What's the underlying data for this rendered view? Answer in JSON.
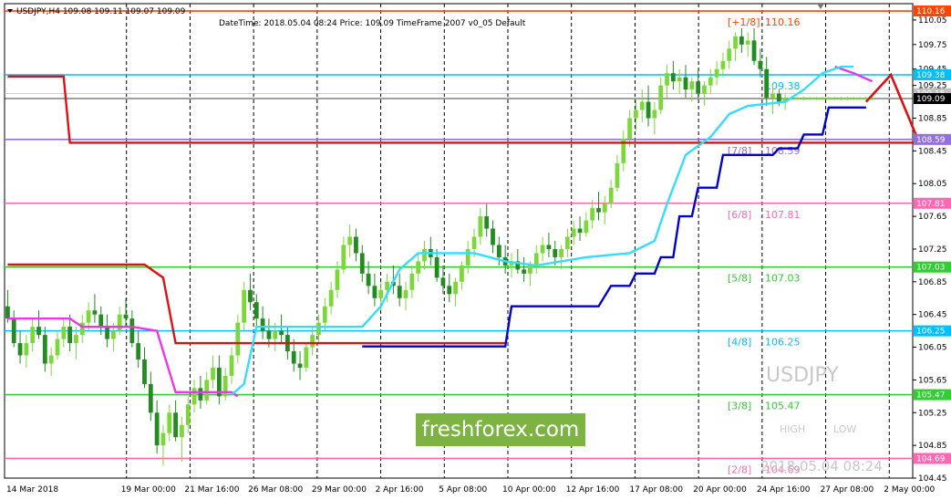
{
  "header": {
    "symbol_info": "USDJPY,H4  109.08 109.11 109.07 109.09",
    "info_line": "DateTime: 2018.05.04 08:24   Price: 109.09   TimeFrame 2007 v0_05   Default"
  },
  "watermark": {
    "symbol": "USDJPY",
    "high_label": "HIGH",
    "low_label": "LOW",
    "timestamp": "2018.05.04 08:24"
  },
  "logo": {
    "text": "freshforex.com"
  },
  "colors": {
    "bear_candle": "#228b22",
    "bull_candle": "#7cd83a",
    "red_line": "#dd1111",
    "blue_line": "#0000cc",
    "cyan_line": "#33ddff",
    "magenta_line": "#ee33ee",
    "badge_gray": "#c0c0c0",
    "badge_black": "#000000"
  },
  "chart_data": {
    "type": "candlestick",
    "ylim": [
      104.45,
      110.25
    ],
    "x_labels": [
      "14 Mar 2018",
      "19 Mar 00:00",
      "21 Mar 16:00",
      "26 Mar 08:00",
      "29 Mar 00:00",
      "2 Apr 16:00",
      "5 Apr 08:00",
      "10 Apr 00:00",
      "12 Apr 16:00",
      "17 Apr 08:00",
      "20 Apr 00:00",
      "24 Apr 16:00",
      "27 Apr 08:00",
      "2 May 00:00"
    ],
    "y_ticks": [
      "110.05",
      "109.75",
      "109.45",
      "109.25",
      "108.85",
      "108.45",
      "108.05",
      "107.65",
      "107.25",
      "106.85",
      "106.45",
      "106.05",
      "105.65",
      "105.25",
      "104.85",
      "104.45"
    ],
    "murrey_levels": [
      {
        "label": "[+1/8]",
        "value_text": "110.16",
        "value": 110.16,
        "color": "#ff4500",
        "show_text": true
      },
      {
        "label": "",
        "value_text": "109.38",
        "value": 109.38,
        "color": "#00bfff",
        "show_text": true
      },
      {
        "label": "[7/8]",
        "value_text": "108.59",
        "value": 108.59,
        "color": "#9370db",
        "show_text": true
      },
      {
        "label": "[6/8]",
        "value_text": "107.81",
        "value": 107.81,
        "color": "#ff69b4",
        "show_text": true
      },
      {
        "label": "[5/8]",
        "value_text": "107.03",
        "value": 107.03,
        "color": "#32cd32",
        "show_text": true
      },
      {
        "label": "[4/8]",
        "value_text": "106.25",
        "value": 106.25,
        "color": "#00bfff",
        "show_text": true
      },
      {
        "label": "[3/8]",
        "value_text": "105.47",
        "value": 105.47,
        "color": "#32cd32",
        "show_text": true
      },
      {
        "label": "[2/8]",
        "value_text": "104.69",
        "value": 104.69,
        "color": "#ff69b4",
        "show_text": true
      }
    ],
    "price_badges": [
      {
        "text": "109.15",
        "value": 109.15,
        "color": "#c0c0c0"
      },
      {
        "text": "109.09",
        "value": 109.09,
        "color": "#000000"
      }
    ],
    "red_line": [
      [
        0,
        109.36
      ],
      [
        9,
        109.36
      ],
      [
        10,
        108.55
      ],
      [
        168,
        108.55
      ],
      [
        170,
        108.55
      ]
    ],
    "red_line2": [
      [
        0,
        107.06
      ],
      [
        22,
        107.06
      ],
      [
        25,
        106.9
      ],
      [
        27,
        106.1
      ],
      [
        80,
        106.1
      ]
    ],
    "blue_line": [
      [
        57,
        106.06
      ],
      [
        80,
        106.06
      ],
      [
        81,
        106.55
      ],
      [
        95,
        106.55
      ],
      [
        97,
        106.8
      ],
      [
        100,
        106.8
      ],
      [
        101,
        106.95
      ],
      [
        104,
        106.95
      ],
      [
        105,
        107.15
      ],
      [
        107,
        107.15
      ],
      [
        108,
        107.65
      ],
      [
        110,
        107.65
      ],
      [
        111,
        108.0
      ],
      [
        114,
        108.0
      ],
      [
        115,
        108.4
      ],
      [
        123,
        108.4
      ],
      [
        124,
        108.48
      ],
      [
        127,
        108.48
      ],
      [
        128,
        108.65
      ],
      [
        131,
        108.65
      ],
      [
        132,
        108.98
      ],
      [
        138,
        108.98
      ]
    ],
    "cyan_line": [
      [
        36,
        105.47
      ],
      [
        38,
        105.6
      ],
      [
        40,
        106.3
      ],
      [
        57,
        106.3
      ],
      [
        60,
        106.55
      ],
      [
        63,
        107.0
      ],
      [
        66,
        107.2
      ],
      [
        75,
        107.2
      ],
      [
        80,
        107.1
      ],
      [
        85,
        107.05
      ],
      [
        93,
        107.15
      ],
      [
        100,
        107.2
      ],
      [
        104,
        107.35
      ],
      [
        106,
        107.8
      ],
      [
        109,
        108.4
      ],
      [
        113,
        108.62
      ],
      [
        116,
        108.9
      ],
      [
        119,
        109.0
      ],
      [
        125,
        109.05
      ],
      [
        128,
        109.2
      ],
      [
        131,
        109.4
      ],
      [
        134,
        109.48
      ],
      [
        136,
        109.48
      ]
    ],
    "magenta_line": [
      [
        0,
        106.4
      ],
      [
        10,
        106.4
      ],
      [
        12,
        106.3
      ],
      [
        20,
        106.3
      ],
      [
        24,
        106.25
      ],
      [
        27,
        105.5
      ],
      [
        36,
        105.5
      ],
      [
        37,
        105.45
      ]
    ],
    "magenta_line2": [
      [
        133,
        109.48
      ],
      [
        136,
        109.4
      ],
      [
        139,
        109.3
      ]
    ],
    "forecast_line": [
      [
        138,
        109.05
      ],
      [
        142,
        109.38
      ],
      [
        146,
        108.65
      ]
    ],
    "n_bars": 140,
    "candles": [
      [
        106.55,
        106.75,
        106.35,
        106.4
      ],
      [
        106.4,
        106.5,
        106.05,
        106.1
      ],
      [
        106.1,
        106.25,
        105.85,
        105.95
      ],
      [
        105.95,
        106.2,
        105.8,
        106.1
      ],
      [
        106.1,
        106.4,
        106.0,
        106.3
      ],
      [
        106.3,
        106.5,
        106.15,
        106.2
      ],
      [
        106.2,
        106.3,
        105.75,
        105.85
      ],
      [
        105.85,
        106.05,
        105.7,
        105.95
      ],
      [
        105.95,
        106.25,
        105.9,
        106.15
      ],
      [
        106.15,
        106.4,
        106.05,
        106.3
      ],
      [
        106.3,
        106.45,
        106.0,
        106.1
      ],
      [
        106.1,
        106.3,
        105.9,
        106.2
      ],
      [
        106.2,
        106.45,
        106.1,
        106.35
      ],
      [
        106.35,
        106.6,
        106.25,
        106.5
      ],
      [
        106.5,
        106.7,
        106.35,
        106.45
      ],
      [
        106.45,
        106.55,
        106.2,
        106.3
      ],
      [
        106.3,
        106.45,
        106.05,
        106.15
      ],
      [
        106.15,
        106.35,
        106.0,
        106.25
      ],
      [
        106.25,
        106.55,
        106.2,
        106.45
      ],
      [
        106.45,
        106.65,
        106.3,
        106.4
      ],
      [
        106.4,
        106.5,
        106.05,
        106.1
      ],
      [
        106.1,
        106.25,
        105.8,
        105.9
      ],
      [
        105.9,
        106.05,
        105.55,
        105.6
      ],
      [
        105.6,
        105.75,
        105.15,
        105.25
      ],
      [
        105.25,
        105.4,
        104.75,
        104.85
      ],
      [
        104.85,
        105.1,
        104.6,
        105.0
      ],
      [
        105.0,
        105.35,
        104.9,
        105.25
      ],
      [
        105.25,
        105.4,
        104.9,
        104.95
      ],
      [
        104.95,
        105.2,
        104.65,
        105.1
      ],
      [
        105.1,
        105.45,
        105.0,
        105.35
      ],
      [
        105.35,
        105.65,
        105.25,
        105.55
      ],
      [
        105.55,
        105.7,
        105.3,
        105.4
      ],
      [
        105.4,
        105.75,
        105.35,
        105.65
      ],
      [
        105.65,
        105.95,
        105.55,
        105.8
      ],
      [
        105.8,
        105.95,
        105.35,
        105.45
      ],
      [
        105.45,
        105.8,
        105.4,
        105.7
      ],
      [
        105.7,
        106.05,
        105.6,
        105.95
      ],
      [
        105.95,
        106.45,
        105.85,
        106.35
      ],
      [
        106.35,
        106.85,
        106.25,
        106.75
      ],
      [
        106.75,
        106.95,
        106.5,
        106.6
      ],
      [
        106.6,
        106.7,
        106.3,
        106.4
      ],
      [
        106.4,
        106.55,
        106.15,
        106.25
      ],
      [
        106.25,
        106.4,
        106.05,
        106.15
      ],
      [
        106.15,
        106.35,
        106.0,
        106.25
      ],
      [
        106.25,
        106.45,
        106.1,
        106.2
      ],
      [
        106.2,
        106.3,
        105.9,
        106.0
      ],
      [
        106.0,
        106.15,
        105.75,
        105.85
      ],
      [
        105.85,
        106.0,
        105.65,
        105.8
      ],
      [
        105.8,
        106.1,
        105.75,
        106.05
      ],
      [
        106.05,
        106.3,
        105.95,
        106.2
      ],
      [
        106.2,
        106.45,
        106.1,
        106.35
      ],
      [
        106.35,
        106.65,
        106.25,
        106.55
      ],
      [
        106.55,
        106.85,
        106.45,
        106.75
      ],
      [
        106.75,
        107.1,
        106.65,
        107.0
      ],
      [
        107.0,
        107.4,
        106.95,
        107.3
      ],
      [
        107.3,
        107.55,
        107.15,
        107.4
      ],
      [
        107.4,
        107.5,
        107.1,
        107.2
      ],
      [
        107.2,
        107.3,
        106.85,
        106.95
      ],
      [
        106.95,
        107.1,
        106.7,
        106.8
      ],
      [
        106.8,
        106.95,
        106.55,
        106.65
      ],
      [
        106.65,
        106.85,
        106.5,
        106.75
      ],
      [
        106.75,
        106.95,
        106.6,
        106.85
      ],
      [
        106.85,
        107.05,
        106.7,
        106.8
      ],
      [
        106.8,
        106.95,
        106.55,
        106.65
      ],
      [
        106.65,
        106.85,
        106.5,
        106.75
      ],
      [
        106.75,
        107.05,
        106.65,
        106.95
      ],
      [
        106.95,
        107.2,
        106.85,
        107.1
      ],
      [
        107.1,
        107.35,
        107.0,
        107.25
      ],
      [
        107.25,
        107.4,
        107.05,
        107.15
      ],
      [
        107.15,
        107.25,
        106.85,
        106.9
      ],
      [
        106.9,
        107.05,
        106.7,
        106.8
      ],
      [
        106.8,
        106.95,
        106.6,
        106.7
      ],
      [
        106.7,
        106.9,
        106.55,
        106.85
      ],
      [
        106.85,
        107.1,
        106.75,
        107.05
      ],
      [
        107.05,
        107.35,
        106.95,
        107.25
      ],
      [
        107.25,
        107.5,
        107.15,
        107.4
      ],
      [
        107.4,
        107.75,
        107.3,
        107.65
      ],
      [
        107.65,
        107.8,
        107.4,
        107.5
      ],
      [
        107.5,
        107.6,
        107.2,
        107.3
      ],
      [
        107.3,
        107.4,
        107.05,
        107.15
      ],
      [
        107.15,
        107.3,
        106.95,
        107.05
      ],
      [
        107.05,
        107.2,
        106.9,
        107.1
      ],
      [
        107.1,
        107.25,
        106.95,
        107.0
      ],
      [
        107.0,
        107.15,
        106.85,
        106.95
      ],
      [
        106.95,
        107.1,
        106.8,
        107.05
      ],
      [
        107.05,
        107.3,
        106.95,
        107.2
      ],
      [
        107.2,
        107.4,
        107.1,
        107.3
      ],
      [
        107.3,
        107.45,
        107.15,
        107.25
      ],
      [
        107.25,
        107.35,
        107.05,
        107.15
      ],
      [
        107.15,
        107.3,
        107.0,
        107.25
      ],
      [
        107.25,
        107.5,
        107.15,
        107.4
      ],
      [
        107.4,
        107.6,
        107.3,
        107.5
      ],
      [
        107.5,
        107.65,
        107.35,
        107.45
      ],
      [
        107.45,
        107.7,
        107.4,
        107.6
      ],
      [
        107.6,
        107.85,
        107.5,
        107.75
      ],
      [
        107.75,
        107.95,
        107.6,
        107.7
      ],
      [
        107.7,
        107.9,
        107.55,
        107.8
      ],
      [
        107.8,
        108.1,
        107.75,
        108.0
      ],
      [
        108.0,
        108.4,
        107.95,
        108.3
      ],
      [
        108.3,
        108.7,
        108.2,
        108.6
      ],
      [
        108.6,
        108.95,
        108.5,
        108.85
      ],
      [
        108.85,
        109.1,
        108.7,
        108.95
      ],
      [
        108.95,
        109.2,
        108.8,
        109.05
      ],
      [
        109.05,
        109.25,
        108.75,
        108.85
      ],
      [
        108.85,
        109.05,
        108.65,
        108.95
      ],
      [
        108.95,
        109.35,
        108.9,
        109.25
      ],
      [
        109.25,
        109.5,
        109.1,
        109.4
      ],
      [
        109.4,
        109.55,
        109.2,
        109.3
      ],
      [
        109.3,
        109.45,
        109.15,
        109.35
      ],
      [
        109.35,
        109.5,
        109.1,
        109.2
      ],
      [
        109.2,
        109.35,
        109.05,
        109.3
      ],
      [
        109.3,
        109.45,
        109.1,
        109.15
      ],
      [
        109.15,
        109.3,
        109.0,
        109.25
      ],
      [
        109.25,
        109.45,
        109.15,
        109.35
      ],
      [
        109.35,
        109.55,
        109.25,
        109.45
      ],
      [
        109.45,
        109.65,
        109.35,
        109.55
      ],
      [
        109.55,
        109.8,
        109.45,
        109.7
      ],
      [
        109.7,
        109.9,
        109.55,
        109.85
      ],
      [
        109.85,
        109.95,
        109.65,
        109.75
      ],
      [
        109.75,
        109.9,
        109.6,
        109.8
      ],
      [
        109.8,
        109.95,
        109.5,
        109.55
      ],
      [
        109.55,
        109.7,
        109.35,
        109.45
      ],
      [
        109.45,
        109.6,
        109.0,
        109.1
      ],
      [
        109.1,
        109.25,
        108.9,
        109.15
      ],
      [
        109.15,
        109.2,
        109.0,
        109.05
      ],
      [
        109.05,
        109.15,
        108.95,
        109.09
      ],
      [
        109.09,
        109.11,
        109.07,
        109.09
      ],
      [
        109.09,
        109.11,
        109.07,
        109.09
      ],
      [
        109.09,
        109.11,
        109.07,
        109.09
      ],
      [
        109.09,
        109.11,
        109.07,
        109.09
      ],
      [
        109.09,
        109.11,
        109.07,
        109.09
      ],
      [
        109.09,
        109.11,
        109.07,
        109.09
      ],
      [
        109.09,
        109.11,
        109.07,
        109.09
      ],
      [
        109.09,
        109.11,
        109.07,
        109.09
      ],
      [
        109.09,
        109.11,
        109.07,
        109.09
      ],
      [
        109.09,
        109.11,
        109.07,
        109.09
      ],
      [
        109.09,
        109.11,
        109.07,
        109.09
      ],
      [
        109.09,
        109.11,
        109.07,
        109.09
      ],
      [
        109.09,
        109.11,
        109.07,
        109.09
      ],
      [
        109.09,
        109.11,
        109.07,
        109.09
      ],
      [
        109.09,
        109.11,
        109.07,
        109.09
      ]
    ]
  }
}
